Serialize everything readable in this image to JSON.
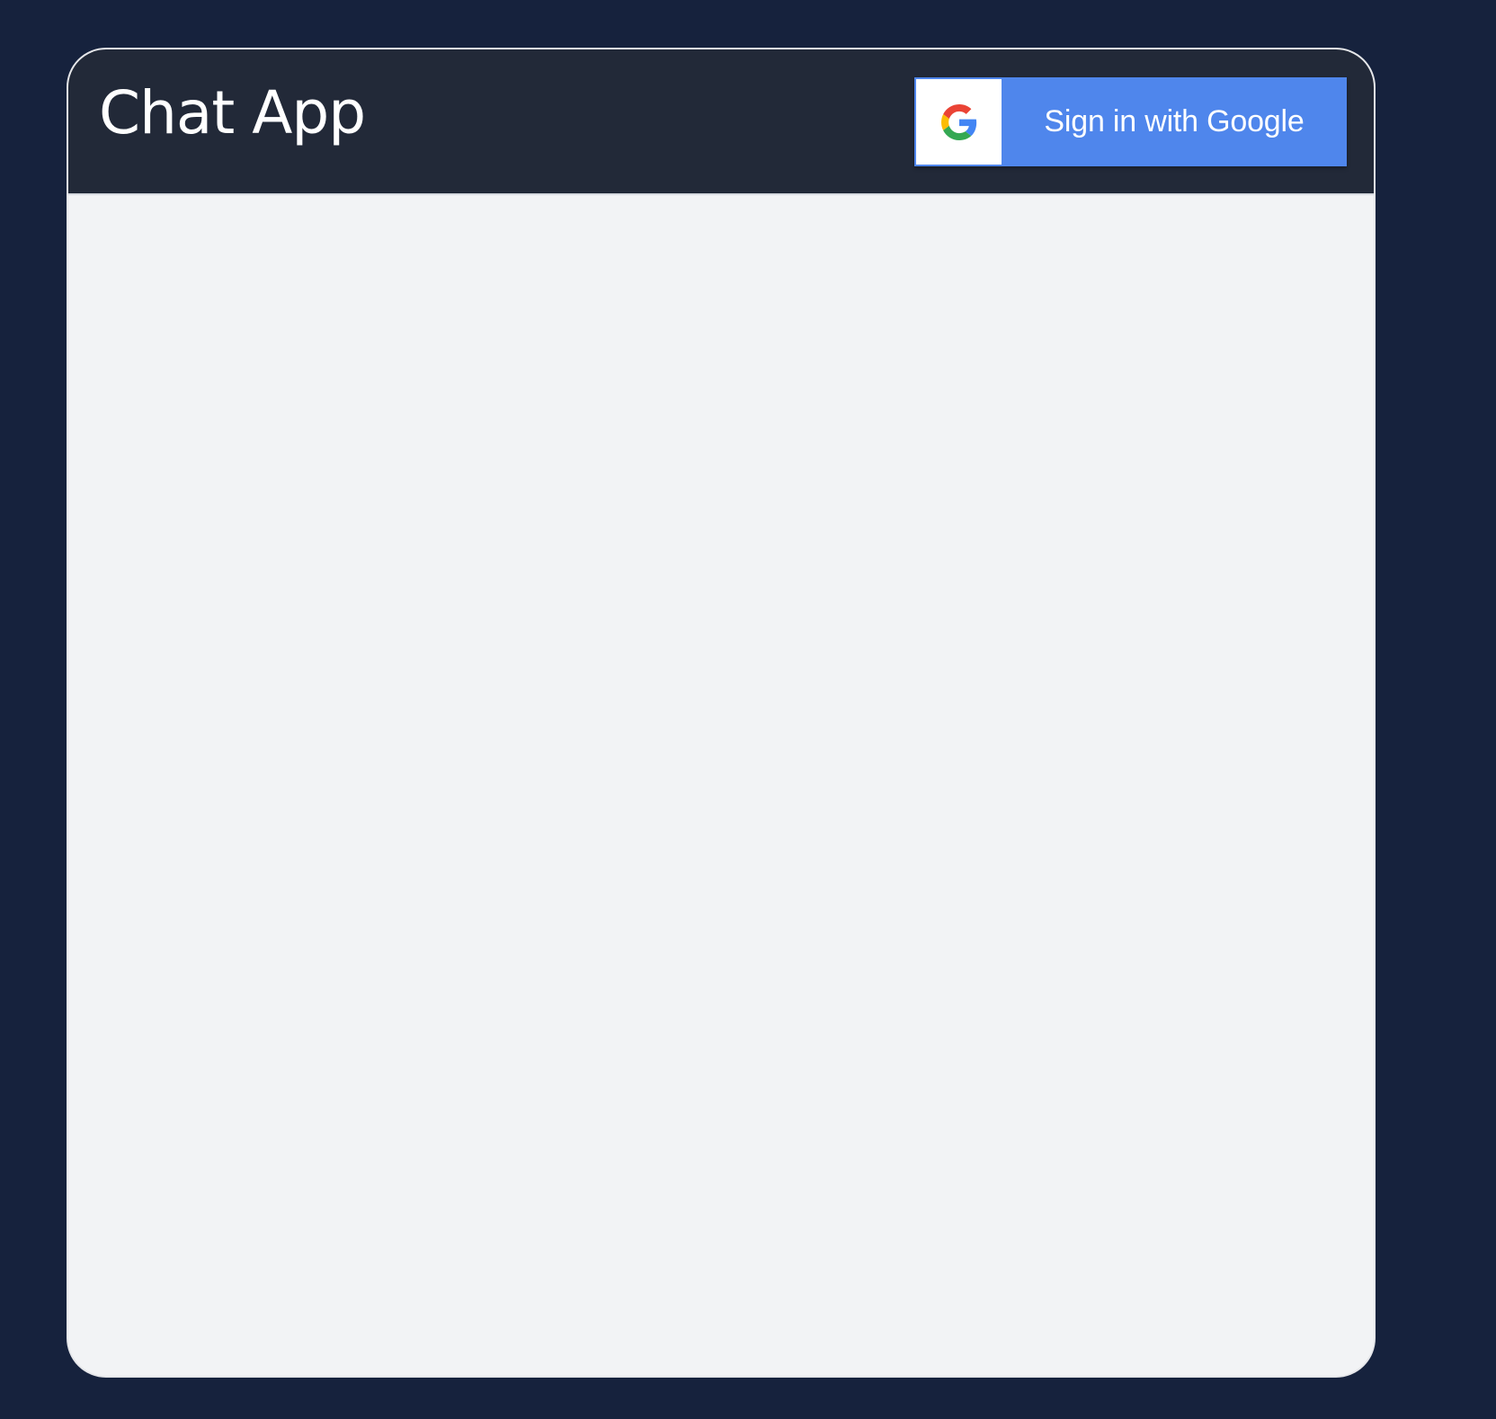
{
  "app": {
    "title": "Chat App"
  },
  "auth": {
    "google_button_label": "Sign in with Google",
    "icon": "google-g-icon"
  },
  "colors": {
    "page_background": "#16223d",
    "header_background": "#222938",
    "content_background": "#f2f3f5",
    "google_blue": "#4f86ec",
    "google_red": "#EA4335",
    "google_yellow": "#FBBC05",
    "google_green": "#34A853",
    "google_blue_logo": "#4285F4"
  }
}
